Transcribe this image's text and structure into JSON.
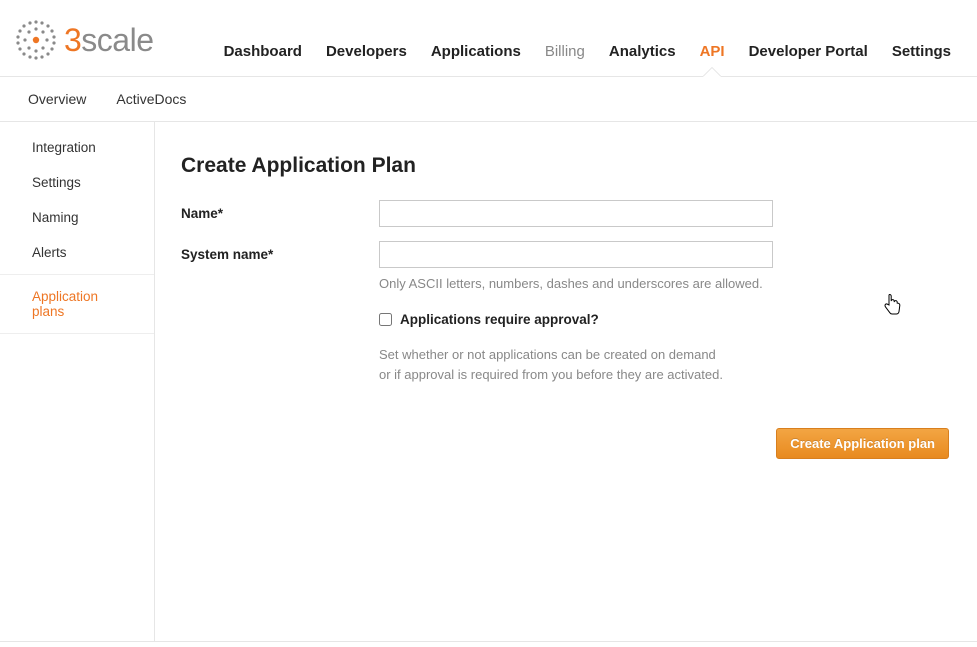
{
  "logo": {
    "num": "3",
    "word": "scale"
  },
  "topnav": [
    {
      "label": "Dashboard",
      "kind": "normal"
    },
    {
      "label": "Developers",
      "kind": "normal"
    },
    {
      "label": "Applications",
      "kind": "normal"
    },
    {
      "label": "Billing",
      "kind": "dim"
    },
    {
      "label": "Analytics",
      "kind": "normal"
    },
    {
      "label": "API",
      "kind": "active"
    },
    {
      "label": "Developer Portal",
      "kind": "normal"
    },
    {
      "label": "Settings",
      "kind": "normal"
    }
  ],
  "subnav": [
    {
      "label": "Overview"
    },
    {
      "label": "ActiveDocs"
    }
  ],
  "sidebar": [
    {
      "label": "Integration",
      "active": false
    },
    {
      "label": "Settings",
      "active": false
    },
    {
      "label": "Naming",
      "active": false
    },
    {
      "label": "Alerts",
      "active": false
    },
    {
      "label": "Application plans",
      "active": true
    }
  ],
  "page": {
    "title": "Create Application Plan",
    "name_label": "Name*",
    "system_name_label": "System name*",
    "system_name_help": "Only ASCII letters, numbers, dashes and underscores are allowed.",
    "approval_label": "Applications require approval?",
    "approval_explain_l1": "Set whether or not applications can be created on demand",
    "approval_explain_l2": "or if approval is required from you before they are activated.",
    "submit_label": "Create Application plan",
    "name_value": "",
    "system_name_value": ""
  }
}
